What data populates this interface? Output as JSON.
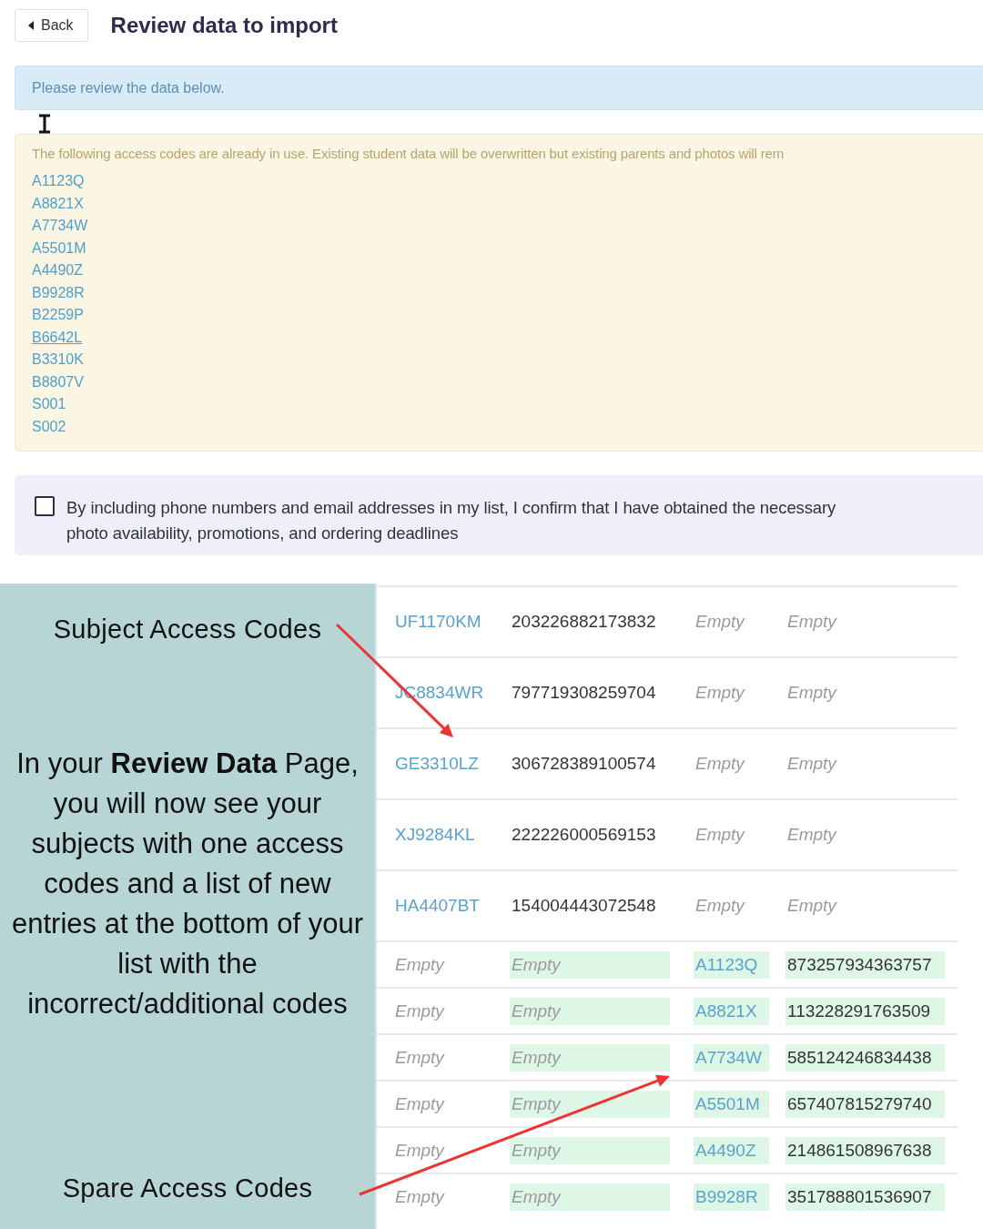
{
  "header": {
    "back_button": "Back",
    "title": "Review data to import"
  },
  "info_banner": "Please review the data below.",
  "warning": {
    "message": "The following access codes are already in use. Existing student data will be overwritten but existing parents and photos will rem",
    "codes": [
      {
        "code": "A1123Q",
        "hovered": false
      },
      {
        "code": "A8821X",
        "hovered": false
      },
      {
        "code": "A7734W",
        "hovered": false
      },
      {
        "code": "A5501M",
        "hovered": false
      },
      {
        "code": "A4490Z",
        "hovered": false
      },
      {
        "code": "B9928R",
        "hovered": false
      },
      {
        "code": "B2259P",
        "hovered": false
      },
      {
        "code": "B6642L",
        "hovered": true
      },
      {
        "code": "B3310K",
        "hovered": false
      },
      {
        "code": "B8807V",
        "hovered": false
      },
      {
        "code": "S001",
        "hovered": false
      },
      {
        "code": "S002",
        "hovered": false
      }
    ]
  },
  "consent": {
    "checked": false,
    "lines": [
      "By including phone numbers and email addresses in my list, I confirm that I have obtained the necessary",
      "photo availability, promotions, and ordering deadlines"
    ]
  },
  "annotation": {
    "top_label": "Subject Access Codes",
    "body": "In your **Review Data** Page, you will now see your subjects with one access codes and a list of new entries at the bottom of your list with the incorrect/additional codes",
    "bottom_label": "Spare Access Codes"
  },
  "table": {
    "rows": [
      {
        "kind": "subject",
        "cells": [
          {
            "kind": "code",
            "text": "UF1170KM",
            "highlighted": false
          },
          {
            "kind": "number",
            "text": "203226882173832",
            "highlighted": false
          },
          {
            "kind": "empty",
            "text": "Empty",
            "highlighted": false
          },
          {
            "kind": "empty",
            "text": "Empty",
            "highlighted": false
          }
        ]
      },
      {
        "kind": "subject",
        "cells": [
          {
            "kind": "code",
            "text": "JC8834WR",
            "highlighted": false
          },
          {
            "kind": "number",
            "text": "797719308259704",
            "highlighted": false
          },
          {
            "kind": "empty",
            "text": "Empty",
            "highlighted": false
          },
          {
            "kind": "empty",
            "text": "Empty",
            "highlighted": false
          }
        ]
      },
      {
        "kind": "subject",
        "cells": [
          {
            "kind": "code",
            "text": "GE3310LZ",
            "highlighted": false
          },
          {
            "kind": "number",
            "text": "306728389100574",
            "highlighted": false
          },
          {
            "kind": "empty",
            "text": "Empty",
            "highlighted": false
          },
          {
            "kind": "empty",
            "text": "Empty",
            "highlighted": false
          }
        ]
      },
      {
        "kind": "subject",
        "cells": [
          {
            "kind": "code",
            "text": "XJ9284KL",
            "highlighted": false
          },
          {
            "kind": "number",
            "text": "222226000569153",
            "highlighted": false
          },
          {
            "kind": "empty",
            "text": "Empty",
            "highlighted": false
          },
          {
            "kind": "empty",
            "text": "Empty",
            "highlighted": false
          }
        ]
      },
      {
        "kind": "subject",
        "cells": [
          {
            "kind": "code",
            "text": "HA4407BT",
            "highlighted": false
          },
          {
            "kind": "number",
            "text": "154004443072548",
            "highlighted": false
          },
          {
            "kind": "empty",
            "text": "Empty",
            "highlighted": false
          },
          {
            "kind": "empty",
            "text": "Empty",
            "highlighted": false
          }
        ]
      },
      {
        "kind": "spare",
        "cells": [
          {
            "kind": "empty",
            "text": "Empty",
            "highlighted": false
          },
          {
            "kind": "empty",
            "text": "Empty",
            "highlighted": true
          },
          {
            "kind": "code",
            "text": "A1123Q",
            "highlighted": true
          },
          {
            "kind": "number",
            "text": "873257934363757",
            "highlighted": true
          }
        ]
      },
      {
        "kind": "spare",
        "cells": [
          {
            "kind": "empty",
            "text": "Empty",
            "highlighted": false
          },
          {
            "kind": "empty",
            "text": "Empty",
            "highlighted": true
          },
          {
            "kind": "code",
            "text": "A8821X",
            "highlighted": true
          },
          {
            "kind": "number",
            "text": "113228291763509",
            "highlighted": true
          }
        ]
      },
      {
        "kind": "spare",
        "cells": [
          {
            "kind": "empty",
            "text": "Empty",
            "highlighted": false
          },
          {
            "kind": "empty",
            "text": "Empty",
            "highlighted": true
          },
          {
            "kind": "code",
            "text": "A7734W",
            "highlighted": true
          },
          {
            "kind": "number",
            "text": "585124246834438",
            "highlighted": true
          }
        ]
      },
      {
        "kind": "spare",
        "cells": [
          {
            "kind": "empty",
            "text": "Empty",
            "highlighted": false
          },
          {
            "kind": "empty",
            "text": "Empty",
            "highlighted": true
          },
          {
            "kind": "code",
            "text": "A5501M",
            "highlighted": true
          },
          {
            "kind": "number",
            "text": "657407815279740",
            "highlighted": true
          }
        ]
      },
      {
        "kind": "spare",
        "cells": [
          {
            "kind": "empty",
            "text": "Empty",
            "highlighted": false
          },
          {
            "kind": "empty",
            "text": "Empty",
            "highlighted": true
          },
          {
            "kind": "code",
            "text": "A4490Z",
            "highlighted": true
          },
          {
            "kind": "number",
            "text": "214861508967638",
            "highlighted": true
          }
        ]
      },
      {
        "kind": "spare",
        "cells": [
          {
            "kind": "empty",
            "text": "Empty",
            "highlighted": false
          },
          {
            "kind": "empty",
            "text": "Empty",
            "highlighted": true
          },
          {
            "kind": "code",
            "text": "B9928R",
            "highlighted": true
          },
          {
            "kind": "number",
            "text": "351788801536907",
            "highlighted": true
          }
        ]
      }
    ]
  }
}
